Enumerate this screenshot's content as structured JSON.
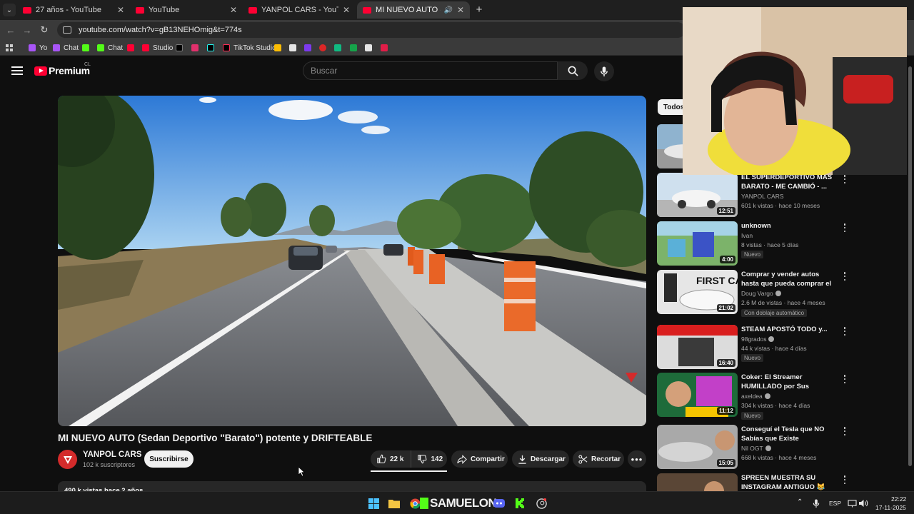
{
  "browser": {
    "tabs": [
      {
        "title": "27 años - YouTube",
        "active": false
      },
      {
        "title": "YouTube",
        "active": false
      },
      {
        "title": "YANPOL CARS - YouTube",
        "active": false
      },
      {
        "title": "MI NUEVO AUTO (Sedan De",
        "active": true
      }
    ],
    "url": "youtube.com/watch?v=gB13NEHOmig&t=774s",
    "bookmarks": [
      "Yo",
      "Chat",
      "Chat",
      "Studio",
      "TikTok Studio"
    ]
  },
  "header": {
    "logo_text": "Premium",
    "country": "CL",
    "search_placeholder": "Buscar"
  },
  "video": {
    "title": "MI NUEVO AUTO (Sedan Deportivo \"Barato\") potente y DRIFTEABLE",
    "channel": "YANPOL CARS",
    "subscribers": "102 k suscriptores",
    "subscribe_label": "Suscribirse",
    "likes": "22 k",
    "dislikes": "142",
    "share_label": "Compartir",
    "download_label": "Descargar",
    "clip_label": "Recortar",
    "description_preview": "490 k vistas  hace 2 años"
  },
  "sidebar": {
    "chip": "Todos",
    "recommendations": [
      {
        "title": "EL SUPERDEPORTIVO MAS BARATO - ME CAMBIÓ - ...",
        "channel": "YANPOL CARS",
        "stats": "601 k vistas · hace 10 meses",
        "duration": "12:51",
        "badge": "",
        "extra": ""
      },
      {
        "title": "unknown",
        "channel": "Ivan",
        "stats": "8 vistas · hace 5 días",
        "duration": "4:00",
        "badge": "Nuevo",
        "extra": ""
      },
      {
        "title": "Comprar y vender autos hasta que pueda comprar el auto de ...",
        "channel": "Doug Vargo",
        "stats": "2.6 M de vistas · hace 4 meses",
        "duration": "21:02",
        "badge": "",
        "extra": "Con doblaje automático"
      },
      {
        "title": "STEAM APOSTÓ TODO y...",
        "channel": "98grados",
        "stats": "44 k vistas · hace 4 días",
        "duration": "16:40",
        "badge": "Nuevo",
        "extra": ""
      },
      {
        "title": "Coker: El Streamer HUMILLADO por Sus AMIGOS frente a Su ...",
        "channel": "axeldea",
        "stats": "304 k vistas · hace 4 días",
        "duration": "11:12",
        "badge": "Nuevo",
        "extra": ""
      },
      {
        "title": "Conseguí el Tesla que NO Sabías que Existe",
        "channel": "Nil OGT",
        "stats": "668 k vistas · hace 4 meses",
        "duration": "15:05",
        "badge": "",
        "extra": ""
      },
      {
        "title": "SPREEN MUESTRA SU INSTAGRAM ANTIGUO 😹😹...",
        "channel": "",
        "stats": "",
        "duration": "",
        "badge": "",
        "extra": ""
      }
    ]
  },
  "taskbar": {
    "apps_label": "SAMUELON",
    "lang": "ESP",
    "time": "22:22",
    "date": "17-11-2025"
  }
}
